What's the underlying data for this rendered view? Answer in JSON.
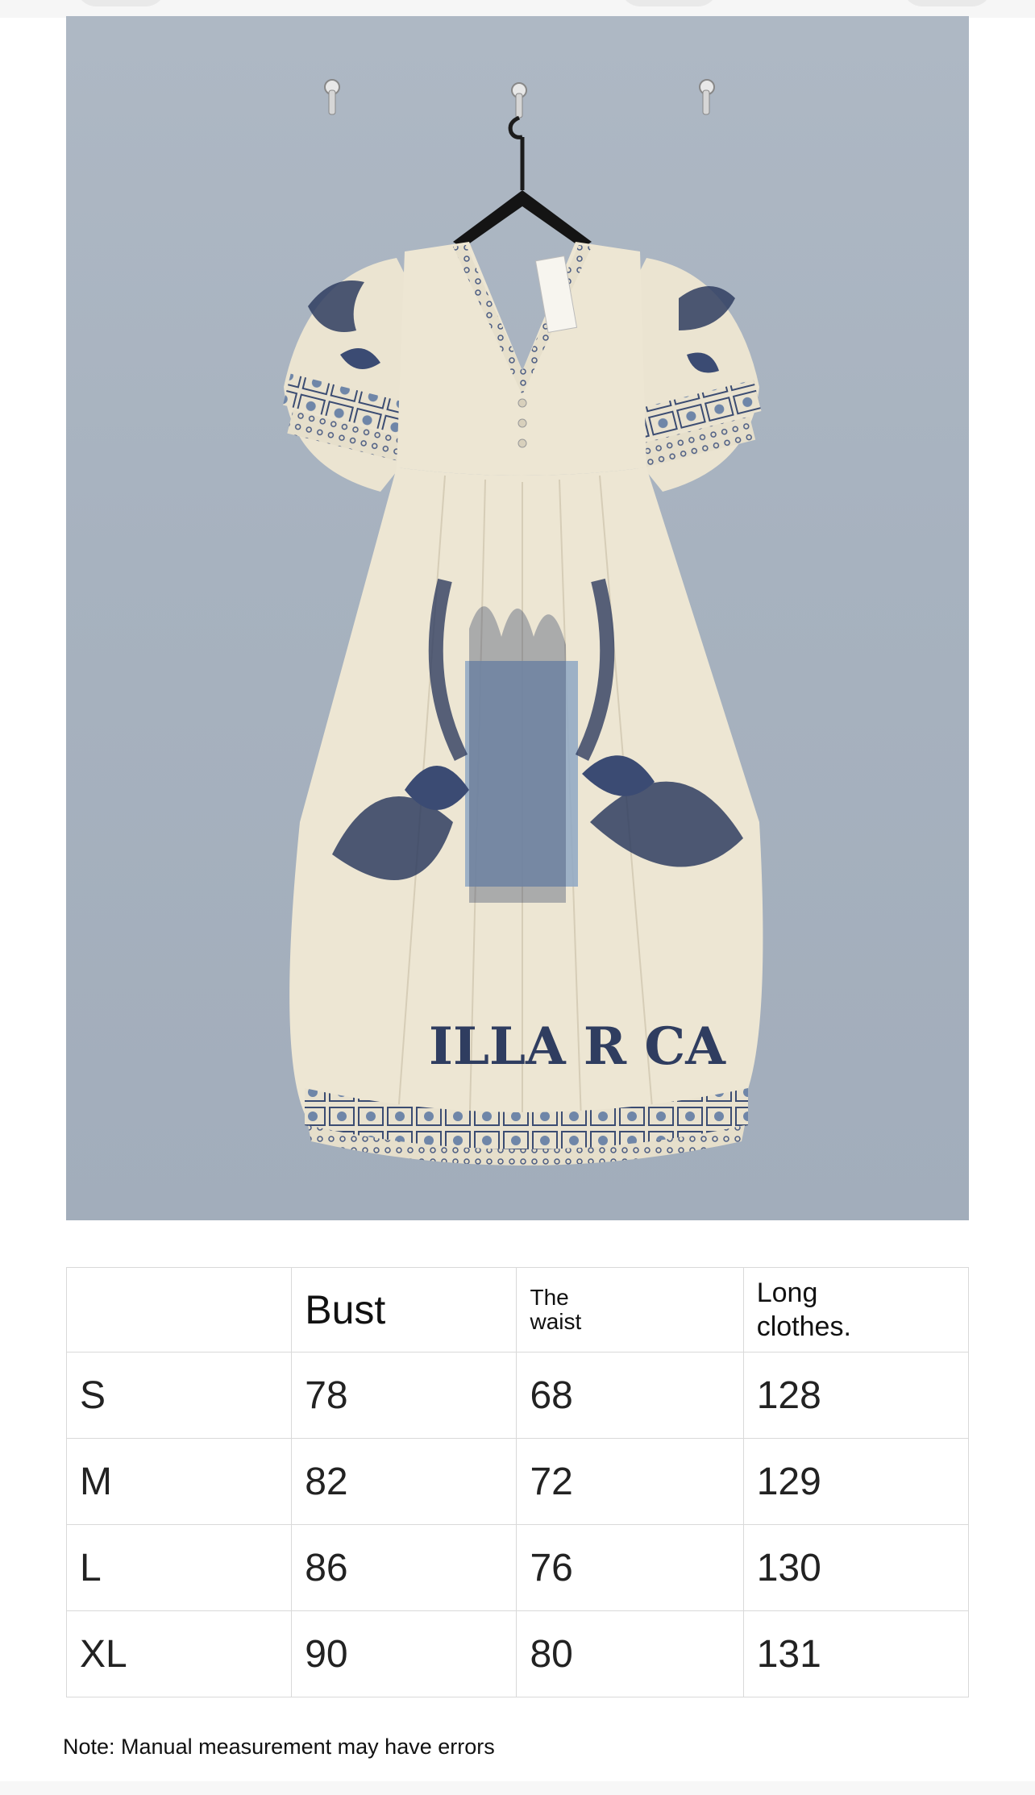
{
  "table": {
    "headers": [
      "",
      "Bust",
      "The waist",
      "Long clothes."
    ],
    "rows": [
      {
        "size": "S",
        "bust": "78",
        "waist": "68",
        "length": "128"
      },
      {
        "size": "M",
        "bust": "82",
        "waist": "72",
        "length": "129"
      },
      {
        "size": "L",
        "bust": "86",
        "waist": "76",
        "length": "130"
      },
      {
        "size": "XL",
        "bust": "90",
        "waist": "80",
        "length": "131"
      }
    ]
  },
  "note": "Note: Manual measurement may have errors",
  "photo": {
    "print_text": "ILLA R CA",
    "colors": {
      "wall": "#a8b3c0",
      "fabric": "#ece5d3",
      "print_navy": "#2f3d60",
      "print_blue": "#93abc4"
    }
  }
}
